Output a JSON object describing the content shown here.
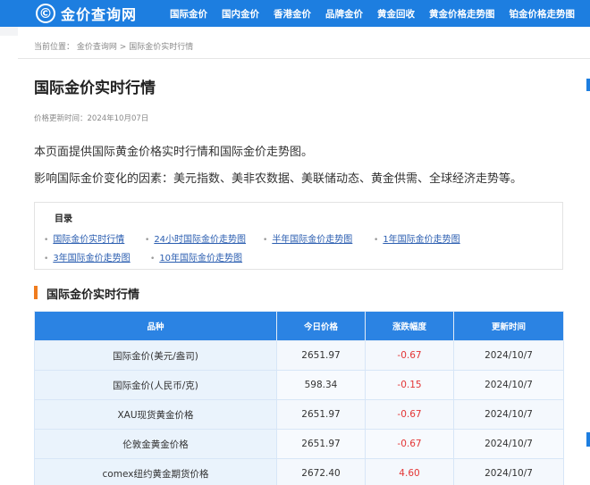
{
  "header": {
    "logo_glyph": "©",
    "logo_text": "金价查询网",
    "nav": [
      "国际金价",
      "国内金价",
      "香港金价",
      "品牌金价",
      "黄金回收",
      "黄金价格走势图",
      "铂金价格走势图"
    ]
  },
  "breadcrumb": {
    "prefix": "当前位置：",
    "items": [
      "金价查询网",
      ">",
      "国际金价实时行情"
    ]
  },
  "page": {
    "title": "国际金价实时行情",
    "update_time": "价格更新时间：2024年10月07日",
    "intro_1": "本页面提供国际黄金价格实时行情和国际金价走势图。",
    "intro_2": "影响国际金价变化的因素：美元指数、美非农数据、美联储动态、黄金供需、全球经济走势等。"
  },
  "toc": {
    "title": "目录",
    "items": [
      "国际金价实时行情",
      "24小时国际金价走势图",
      "半年国际金价走势图",
      "1年国际金价走势图",
      "3年国际金价走势图",
      "10年国际金价走势图"
    ]
  },
  "section": {
    "title": "国际金价实时行情"
  },
  "table": {
    "headers": [
      "品种",
      "今日价格",
      "涨跌幅度",
      "更新时间"
    ],
    "rows": [
      {
        "name": "国际金价(美元/盎司)",
        "price": "2651.97",
        "change": "-0.67",
        "time": "2024/10/7"
      },
      {
        "name": "国际金价(人民币/克)",
        "price": "598.34",
        "change": "-0.15",
        "time": "2024/10/7"
      },
      {
        "name": "XAU现货黄金价格",
        "price": "2651.97",
        "change": "-0.67",
        "time": "2024/10/7"
      },
      {
        "name": "伦敦金黄金价格",
        "price": "2651.97",
        "change": "-0.67",
        "time": "2024/10/7"
      },
      {
        "name": "comex纽约黄金期货价格",
        "price": "2672.40",
        "change": "4.60",
        "time": "2024/10/7"
      }
    ]
  },
  "colors": {
    "primary": "#1d7ee0",
    "table_header": "#2b83e3",
    "accent": "#f07c1e",
    "change": "#e33535",
    "link": "#2a5db0"
  }
}
